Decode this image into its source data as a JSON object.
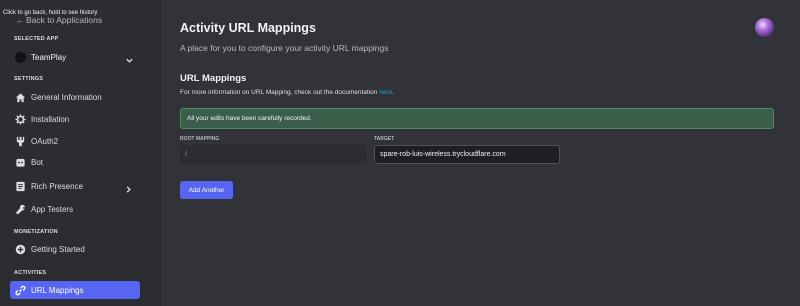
{
  "tooltip": "Click to go back, hold to see history",
  "sidebar": {
    "back_label": "Back to Applications",
    "selected_app_heading": "SELECTED APP",
    "app_name": "TeamPlay",
    "settings_heading": "SETTINGS",
    "settings_items": [
      {
        "label": "General Information",
        "icon": "home-icon"
      },
      {
        "label": "Installation",
        "icon": "gear-icon"
      },
      {
        "label": "OAuth2",
        "icon": "wrench-icon"
      },
      {
        "label": "Bot",
        "icon": "bot-icon"
      },
      {
        "label": "Rich Presence",
        "icon": "presence-icon"
      },
      {
        "label": "App Testers",
        "icon": "wrench-icon"
      }
    ],
    "monetization_heading": "MONETIZATION",
    "monetization_items": [
      {
        "label": "Getting Started",
        "icon": "plus-circle-icon"
      }
    ],
    "activities_heading": "ACTIVITIES",
    "activities_items": [
      {
        "label": "URL Mappings",
        "icon": "link-icon",
        "active": true
      }
    ]
  },
  "main": {
    "title": "Activity URL Mappings",
    "subtitle": "A place for you to configure your activity URL mappings",
    "section_title": "URL Mappings",
    "info_text": "For more information on URL Mapping, check out the documentation ",
    "info_link": "here",
    "info_suffix": ".",
    "success_message": "All your edits have been carefully recorded.",
    "root_label": "ROOT MAPPING",
    "target_label": "TARGET",
    "root_value": "/",
    "target_value": "spare-rob-luis-wireless.trycloudflare.com",
    "add_button": "Add Another"
  },
  "colors": {
    "accent": "#5865f2",
    "success_bg": "#3b5e4a",
    "link": "#00a8fc"
  }
}
